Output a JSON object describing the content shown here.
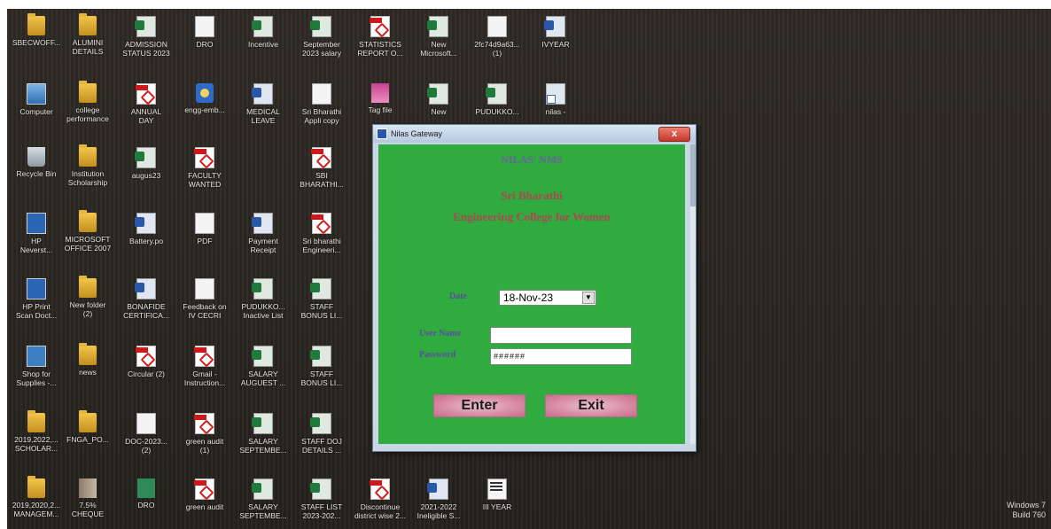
{
  "desktop": {
    "icons": [
      {
        "label": "SBECWOFF...",
        "kind": "folder"
      },
      {
        "label": "ALUMINI\nDETAILS",
        "kind": "folder"
      },
      {
        "label": "ADMISSION\nSTATUS 2023",
        "kind": "excel"
      },
      {
        "label": "DRO",
        "kind": "doc"
      },
      {
        "label": "Incentive",
        "kind": "excel"
      },
      {
        "label": "September\n2023 salary",
        "kind": "excel"
      },
      {
        "label": "STATISTICS\nREPORT O...",
        "kind": "pdf"
      },
      {
        "label": "New\nMicrosoft...",
        "kind": "excel"
      },
      {
        "label": "2fc74d9a63...\n(1)",
        "kind": "doc"
      },
      {
        "label": "IVYEAR",
        "kind": "word"
      },
      {
        "label": "Computer",
        "kind": "computer"
      },
      {
        "label": "college\nperformance",
        "kind": "folder"
      },
      {
        "label": "ANNUAL\nDAY",
        "kind": "pdf"
      },
      {
        "label": "engg-emb...",
        "kind": "disk"
      },
      {
        "label": "MEDICAL\nLEAVE",
        "kind": "word"
      },
      {
        "label": "Sri Bharathi\nAppli copy",
        "kind": "doc"
      },
      {
        "label": "Tag file",
        "kind": "rar"
      },
      {
        "label": "New",
        "kind": "excel"
      },
      {
        "label": "PUDUKKO...",
        "kind": "excel"
      },
      {
        "label": "nilas -",
        "kind": "shortcut"
      },
      {
        "label": "Recycle Bin",
        "kind": "bin"
      },
      {
        "label": "Institution\nScholarship",
        "kind": "folder"
      },
      {
        "label": "augus23",
        "kind": "excel"
      },
      {
        "label": "FACULTY\nWANTED",
        "kind": "pdf"
      },
      {
        "label": "SBI\nBHARATHI...",
        "kind": "pdf"
      },
      {
        "label": "HP\nNeverst...",
        "kind": "hp"
      },
      {
        "label": "MICROSOFT\nOFFICE 2007",
        "kind": "folder"
      },
      {
        "label": "Battery.po",
        "kind": "word"
      },
      {
        "label": "PDF",
        "kind": "doc"
      },
      {
        "label": "Payment\nReceipt",
        "kind": "word"
      },
      {
        "label": "Sri bharathi\nEngineeri...",
        "kind": "pdf"
      },
      {
        "label": "HP Print\nScan Doct...",
        "kind": "hp"
      },
      {
        "label": "New folder\n(2)",
        "kind": "folder"
      },
      {
        "label": "BONAFIDE\nCERTIFICA...",
        "kind": "word"
      },
      {
        "label": "Feedback on\nIV CECRI",
        "kind": "doc"
      },
      {
        "label": "PUDUKKO...\nInactive List",
        "kind": "excel"
      },
      {
        "label": "STAFF\nBONUS LI...",
        "kind": "excel"
      },
      {
        "label": "Shop for\nSupplies -...",
        "kind": "shop"
      },
      {
        "label": "news",
        "kind": "folder"
      },
      {
        "label": "Circular (2)",
        "kind": "pdf"
      },
      {
        "label": "Gmail -\nInstruction...",
        "kind": "pdf"
      },
      {
        "label": "SALARY\nAUGUEST ...",
        "kind": "excel"
      },
      {
        "label": "STAFF\nBONUS LI...",
        "kind": "excel"
      },
      {
        "label": "2019,2022,...\nSCHOLAR...",
        "kind": "folder"
      },
      {
        "label": "FNGA_PO...",
        "kind": "folder"
      },
      {
        "label": "DOC-2023...\n(2)",
        "kind": "doc"
      },
      {
        "label": "green audit\n(1)",
        "kind": "pdf"
      },
      {
        "label": "SALARY\nSEPTEMBE...",
        "kind": "excel"
      },
      {
        "label": "STAFF DOJ\nDETAILS ...",
        "kind": "excel"
      },
      {
        "label": "2019,2020,2...\nMANAGEM...",
        "kind": "folder"
      },
      {
        "label": "7.5%\nCHEQUE",
        "kind": "cheque"
      },
      {
        "label": "DRO",
        "kind": "greenbar"
      },
      {
        "label": "green audit",
        "kind": "pdf"
      },
      {
        "label": "SALARY\nSEPTEMBE...",
        "kind": "excel"
      },
      {
        "label": "STAFF LIST\n2023-202...",
        "kind": "excel"
      },
      {
        "label": "Discontinue\ndistrict wise 2...",
        "kind": "pdf"
      },
      {
        "label": "2021-2022\nIneligible S...",
        "kind": "word"
      },
      {
        "label": "III YEAR",
        "kind": "exe"
      }
    ],
    "watermark": {
      "line1": "Windows 7",
      "line2": "Build 760"
    }
  },
  "dialog": {
    "title": "Nilas Gateway",
    "close_label": "x",
    "product": "NILAS' NMS",
    "college_line1": "Sri Bharathi",
    "college_line2": "Engineering College for Women",
    "date_label": "Date",
    "date_value": "18-Nov-23",
    "username_label": "User Name",
    "username_value": "",
    "password_label": "Password",
    "password_value": "######",
    "enter_label": "Enter",
    "exit_label": "Exit"
  },
  "colors": {
    "desktop_bg": "#2a2622",
    "dialog_client": "#2fab40",
    "button_pink": "#d98aa5",
    "brand_red": "#b0464f",
    "label_purple": "#5b4f9e"
  }
}
